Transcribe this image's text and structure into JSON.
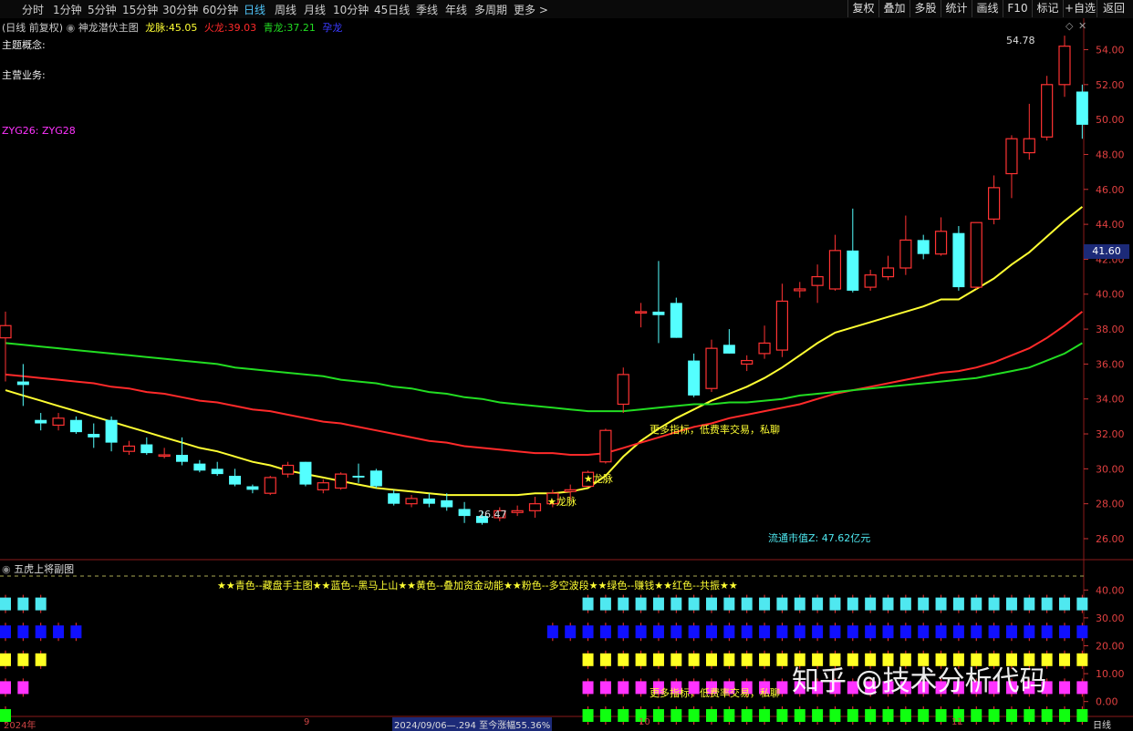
{
  "toolbar": {
    "timeframes": [
      {
        "label": "分时",
        "active": false
      },
      {
        "label": "1分钟",
        "active": false
      },
      {
        "label": "5分钟",
        "active": false
      },
      {
        "label": "15分钟",
        "active": false
      },
      {
        "label": "30分钟",
        "active": false
      },
      {
        "label": "60分钟",
        "active": false
      },
      {
        "label": "日线",
        "active": true
      },
      {
        "label": "周线",
        "active": false
      },
      {
        "label": "月线",
        "active": false
      },
      {
        "label": "10分钟",
        "active": false
      },
      {
        "label": "45日线",
        "active": false
      },
      {
        "label": "季线",
        "active": false
      },
      {
        "label": "年线",
        "active": false
      },
      {
        "label": "多周期",
        "active": false
      },
      {
        "label": "更多 >",
        "active": false
      }
    ],
    "buttons": [
      "复权",
      "叠加",
      "多股",
      "统计",
      "画线",
      "F10",
      "标记",
      "+自选",
      "返回"
    ]
  },
  "main": {
    "period_label": "(日线 前复权)",
    "indicator_name": "神龙潜伏主图",
    "lines_info": [
      {
        "label": "龙脉:",
        "value": "45.05",
        "color": "#ffff33"
      },
      {
        "label": "火龙:",
        "value": "39.03",
        "color": "#ff2a2a"
      },
      {
        "label": "青龙:",
        "value": "37.21",
        "color": "#22dd22"
      },
      {
        "label": "孕龙",
        "value": "",
        "color": "#3a3aff"
      }
    ],
    "theme_label": "主题概念:",
    "business_label": "主营业务:",
    "zyg_label": "ZYG26: ZYG28",
    "price_box": "41.60",
    "float_cap": "流通市值Z: 47.62亿元",
    "high_label": "54.78",
    "low_label": "26.47",
    "annotations": {
      "dragon1": "★龙脉",
      "dragon2": "★龙脉",
      "more_text": "更多指标，低费率交易，私聊"
    }
  },
  "sub": {
    "title": "五虎上将副图",
    "legend": "★★青色--藏盘手主图★★蓝色--黑马上山★★黄色--叠加资金动能★★粉色--多空波段★★绿色--赚钱★★红色--共振★★",
    "more_text": "更多指标，低费率交易，私聊",
    "row_colors": [
      "#4fe8f0",
      "#1010ff",
      "#ffff22",
      "#ff33ff",
      "#10ff10",
      "#ff1010"
    ]
  },
  "bottom_bar": {
    "date_left": "2024年",
    "month_9": "9",
    "date_range": "2024/09/06—.294 至今涨幅55.36%",
    "month_10": "10",
    "month_11": "11",
    "right_label": "日线"
  },
  "watermark": "知乎 @技术分析代码",
  "chart_data": {
    "type": "candlestick",
    "y_ticks": [
      "54.00",
      "52.00",
      "50.00",
      "48.00",
      "46.00",
      "44.00",
      "42.00",
      "40.00",
      "38.00",
      "36.00",
      "34.00",
      "32.00",
      "30.00",
      "28.00",
      "26.00"
    ],
    "sub_y_ticks": [
      "40.00",
      "30.00",
      "20.00",
      "10.00",
      "0.00"
    ],
    "ylim": [
      24.8,
      55.8
    ],
    "sub_ylim": [
      -5,
      45
    ],
    "candles": [
      [
        37.5,
        39.0,
        35.0,
        38.2
      ],
      [
        35.0,
        36.0,
        33.6,
        34.8
      ],
      [
        32.8,
        33.2,
        32.2,
        32.6
      ],
      [
        32.5,
        33.2,
        32.2,
        32.9
      ],
      [
        32.8,
        33.0,
        32.0,
        32.1
      ],
      [
        32.0,
        32.6,
        31.2,
        31.8
      ],
      [
        32.8,
        33.0,
        31.0,
        31.5
      ],
      [
        31.0,
        31.6,
        30.8,
        31.3
      ],
      [
        31.4,
        31.8,
        30.8,
        30.9
      ],
      [
        30.8,
        31.2,
        30.6,
        30.8
      ],
      [
        30.8,
        31.8,
        30.2,
        30.4
      ],
      [
        30.3,
        30.5,
        29.8,
        29.9
      ],
      [
        30.0,
        30.4,
        29.6,
        29.7
      ],
      [
        29.6,
        30.0,
        29.0,
        29.1
      ],
      [
        29.0,
        29.1,
        28.6,
        28.8
      ],
      [
        28.6,
        29.6,
        28.5,
        29.5
      ],
      [
        29.7,
        30.4,
        29.5,
        30.2
      ],
      [
        30.4,
        30.4,
        29.0,
        29.1
      ],
      [
        28.8,
        29.4,
        28.6,
        29.2
      ],
      [
        28.9,
        29.8,
        28.8,
        29.7
      ],
      [
        29.6,
        30.3,
        29.2,
        29.5
      ],
      [
        29.9,
        30.0,
        28.9,
        29.0
      ],
      [
        28.6,
        28.8,
        27.9,
        28.0
      ],
      [
        28.0,
        28.5,
        27.8,
        28.3
      ],
      [
        28.3,
        28.6,
        27.8,
        28.0
      ],
      [
        28.2,
        28.6,
        27.6,
        27.8
      ],
      [
        27.7,
        28.1,
        26.9,
        27.3
      ],
      [
        27.3,
        27.6,
        26.8,
        26.9
      ],
      [
        27.2,
        27.8,
        27.0,
        27.6
      ],
      [
        27.5,
        27.9,
        27.3,
        27.6
      ],
      [
        27.6,
        28.4,
        27.2,
        28.0
      ],
      [
        28.0,
        28.8,
        27.8,
        28.6
      ],
      [
        28.7,
        29.1,
        28.2,
        28.8
      ],
      [
        29.0,
        29.9,
        29.0,
        29.8
      ],
      [
        30.4,
        32.3,
        30.3,
        32.2
      ],
      [
        33.7,
        35.8,
        33.2,
        35.4
      ],
      [
        39.0,
        39.5,
        38.1,
        39.0
      ],
      [
        39.0,
        41.9,
        37.2,
        38.8
      ],
      [
        39.5,
        39.8,
        37.5,
        37.5
      ],
      [
        36.2,
        36.6,
        34.1,
        34.2
      ],
      [
        34.6,
        37.4,
        34.4,
        36.9
      ],
      [
        37.1,
        38.0,
        36.6,
        36.6
      ],
      [
        36.0,
        36.5,
        35.6,
        36.2
      ],
      [
        36.6,
        38.2,
        36.3,
        37.2
      ],
      [
        36.8,
        40.6,
        36.4,
        39.6
      ],
      [
        40.2,
        40.7,
        39.8,
        40.3
      ],
      [
        40.5,
        41.7,
        39.5,
        41.0
      ],
      [
        40.3,
        43.4,
        40.2,
        42.5
      ],
      [
        42.5,
        44.9,
        40.1,
        40.2
      ],
      [
        40.4,
        41.4,
        40.2,
        41.1
      ],
      [
        41.0,
        42.2,
        40.8,
        41.5
      ],
      [
        41.5,
        44.5,
        41.1,
        43.1
      ],
      [
        43.1,
        43.4,
        42.0,
        42.3
      ],
      [
        42.3,
        44.4,
        42.2,
        43.6
      ],
      [
        43.5,
        43.9,
        40.2,
        40.4
      ],
      [
        40.4,
        44.1,
        40.3,
        44.1
      ],
      [
        44.3,
        46.8,
        44.0,
        46.1
      ],
      [
        46.9,
        49.1,
        45.5,
        48.9
      ],
      [
        48.1,
        50.9,
        47.7,
        48.9
      ],
      [
        49.0,
        52.5,
        48.8,
        52.0
      ],
      [
        52.0,
        54.8,
        51.3,
        54.2
      ],
      [
        51.6,
        52.0,
        48.9,
        49.7
      ]
    ],
    "series": [
      {
        "name": "龙脉",
        "color": "#ffff33",
        "values": [
          34.5,
          34.2,
          33.9,
          33.6,
          33.3,
          33.0,
          32.7,
          32.4,
          32.1,
          31.8,
          31.5,
          31.2,
          31.0,
          30.7,
          30.4,
          30.2,
          29.9,
          29.7,
          29.5,
          29.3,
          29.1,
          28.9,
          28.8,
          28.7,
          28.6,
          28.5,
          28.5,
          28.5,
          28.5,
          28.5,
          28.6,
          28.6,
          28.7,
          28.9,
          29.6,
          30.7,
          31.6,
          32.3,
          32.9,
          33.4,
          33.9,
          34.3,
          34.7,
          35.2,
          35.8,
          36.5,
          37.2,
          37.8,
          38.1,
          38.4,
          38.7,
          39.0,
          39.3,
          39.7,
          39.7,
          40.3,
          40.9,
          41.7,
          42.4,
          43.3,
          44.2,
          45.0
        ]
      },
      {
        "name": "火龙",
        "color": "#ff2a2a",
        "values": [
          35.4,
          35.3,
          35.2,
          35.1,
          35.0,
          34.9,
          34.7,
          34.6,
          34.4,
          34.3,
          34.1,
          33.9,
          33.8,
          33.6,
          33.4,
          33.3,
          33.1,
          32.9,
          32.7,
          32.6,
          32.4,
          32.2,
          32.0,
          31.8,
          31.6,
          31.5,
          31.3,
          31.2,
          31.1,
          31.0,
          30.9,
          30.9,
          30.8,
          30.8,
          30.9,
          31.2,
          31.5,
          31.8,
          32.1,
          32.4,
          32.6,
          32.9,
          33.1,
          33.3,
          33.5,
          33.7,
          34.0,
          34.3,
          34.5,
          34.7,
          34.9,
          35.1,
          35.3,
          35.5,
          35.6,
          35.8,
          36.1,
          36.5,
          36.9,
          37.5,
          38.2,
          39.0
        ]
      },
      {
        "name": "青龙",
        "color": "#22dd22",
        "values": [
          37.2,
          37.1,
          37.0,
          36.9,
          36.8,
          36.7,
          36.6,
          36.5,
          36.4,
          36.3,
          36.2,
          36.1,
          36.0,
          35.8,
          35.7,
          35.6,
          35.5,
          35.4,
          35.3,
          35.1,
          35.0,
          34.9,
          34.7,
          34.6,
          34.4,
          34.3,
          34.1,
          34.0,
          33.8,
          33.7,
          33.6,
          33.5,
          33.4,
          33.3,
          33.3,
          33.3,
          33.4,
          33.5,
          33.6,
          33.7,
          33.7,
          33.8,
          33.8,
          33.9,
          34.0,
          34.2,
          34.3,
          34.4,
          34.5,
          34.6,
          34.7,
          34.8,
          34.9,
          35.0,
          35.1,
          35.2,
          35.4,
          35.6,
          35.8,
          36.2,
          36.6,
          37.2
        ]
      }
    ],
    "signal_rows": [
      {
        "level": 35,
        "color": "#4fe8f0",
        "active": [
          1,
          1,
          1,
          0,
          0,
          0,
          0,
          0,
          0,
          0,
          0,
          0,
          0,
          0,
          0,
          0,
          0,
          0,
          0,
          0,
          0,
          0,
          0,
          0,
          0,
          0,
          0,
          0,
          0,
          0,
          0,
          0,
          0,
          1,
          1,
          1,
          1,
          1,
          1,
          1,
          1,
          1,
          1,
          1,
          1,
          1,
          1,
          1,
          1,
          1,
          1,
          1,
          1,
          1,
          1,
          1,
          1,
          1,
          1,
          1,
          1,
          1
        ]
      },
      {
        "level": 25,
        "color": "#1010ff",
        "active": [
          1,
          1,
          1,
          1,
          1,
          0,
          0,
          0,
          0,
          0,
          0,
          0,
          0,
          0,
          0,
          0,
          0,
          0,
          0,
          0,
          0,
          0,
          0,
          0,
          0,
          0,
          0,
          0,
          0,
          0,
          0,
          1,
          1,
          1,
          1,
          1,
          1,
          1,
          1,
          1,
          1,
          1,
          1,
          1,
          1,
          1,
          1,
          1,
          1,
          1,
          1,
          1,
          1,
          1,
          1,
          1,
          1,
          1,
          1,
          1,
          1,
          1
        ]
      },
      {
        "level": 15,
        "color": "#ffff22",
        "active": [
          1,
          1,
          1,
          0,
          0,
          0,
          0,
          0,
          0,
          0,
          0,
          0,
          0,
          0,
          0,
          0,
          0,
          0,
          0,
          0,
          0,
          0,
          0,
          0,
          0,
          0,
          0,
          0,
          0,
          0,
          0,
          0,
          0,
          1,
          1,
          1,
          1,
          1,
          1,
          1,
          1,
          1,
          1,
          1,
          1,
          1,
          1,
          1,
          1,
          1,
          1,
          1,
          1,
          1,
          1,
          1,
          1,
          1,
          1,
          1,
          1,
          1
        ]
      },
      {
        "level": 5,
        "color": "#ff33ff",
        "active": [
          1,
          1,
          0,
          0,
          0,
          0,
          0,
          0,
          0,
          0,
          0,
          0,
          0,
          0,
          0,
          0,
          0,
          0,
          0,
          0,
          0,
          0,
          0,
          0,
          0,
          0,
          0,
          0,
          0,
          0,
          0,
          0,
          0,
          1,
          1,
          1,
          1,
          1,
          1,
          1,
          1,
          1,
          1,
          1,
          1,
          1,
          1,
          1,
          1,
          1,
          1,
          1,
          1,
          1,
          1,
          1,
          1,
          1,
          1,
          1,
          1,
          1
        ]
      },
      {
        "level": -5,
        "color": "#10ff10",
        "active": [
          1,
          0,
          0,
          0,
          0,
          0,
          0,
          0,
          0,
          0,
          0,
          0,
          0,
          0,
          0,
          0,
          0,
          0,
          0,
          0,
          0,
          0,
          0,
          0,
          0,
          0,
          0,
          0,
          0,
          0,
          0,
          0,
          0,
          1,
          1,
          1,
          1,
          1,
          1,
          1,
          1,
          1,
          1,
          1,
          1,
          1,
          1,
          1,
          1,
          1,
          1,
          1,
          1,
          1,
          1,
          1,
          1,
          1,
          1,
          1,
          1,
          1
        ]
      },
      {
        "level": -15,
        "color": "#ff1010",
        "active": [
          0,
          0,
          0,
          0,
          0,
          0,
          0,
          0,
          0,
          0,
          0,
          0,
          0,
          0,
          0,
          0,
          0,
          0,
          0,
          0,
          0,
          0,
          0,
          0,
          0,
          0,
          0,
          0,
          0,
          0,
          0,
          0,
          0,
          1,
          1,
          1,
          1,
          1,
          1,
          1,
          1,
          1,
          1,
          1,
          1,
          1,
          1,
          1,
          1,
          1,
          1,
          1,
          1,
          1,
          1,
          1,
          1,
          1,
          1,
          1,
          1,
          1
        ]
      }
    ]
  }
}
